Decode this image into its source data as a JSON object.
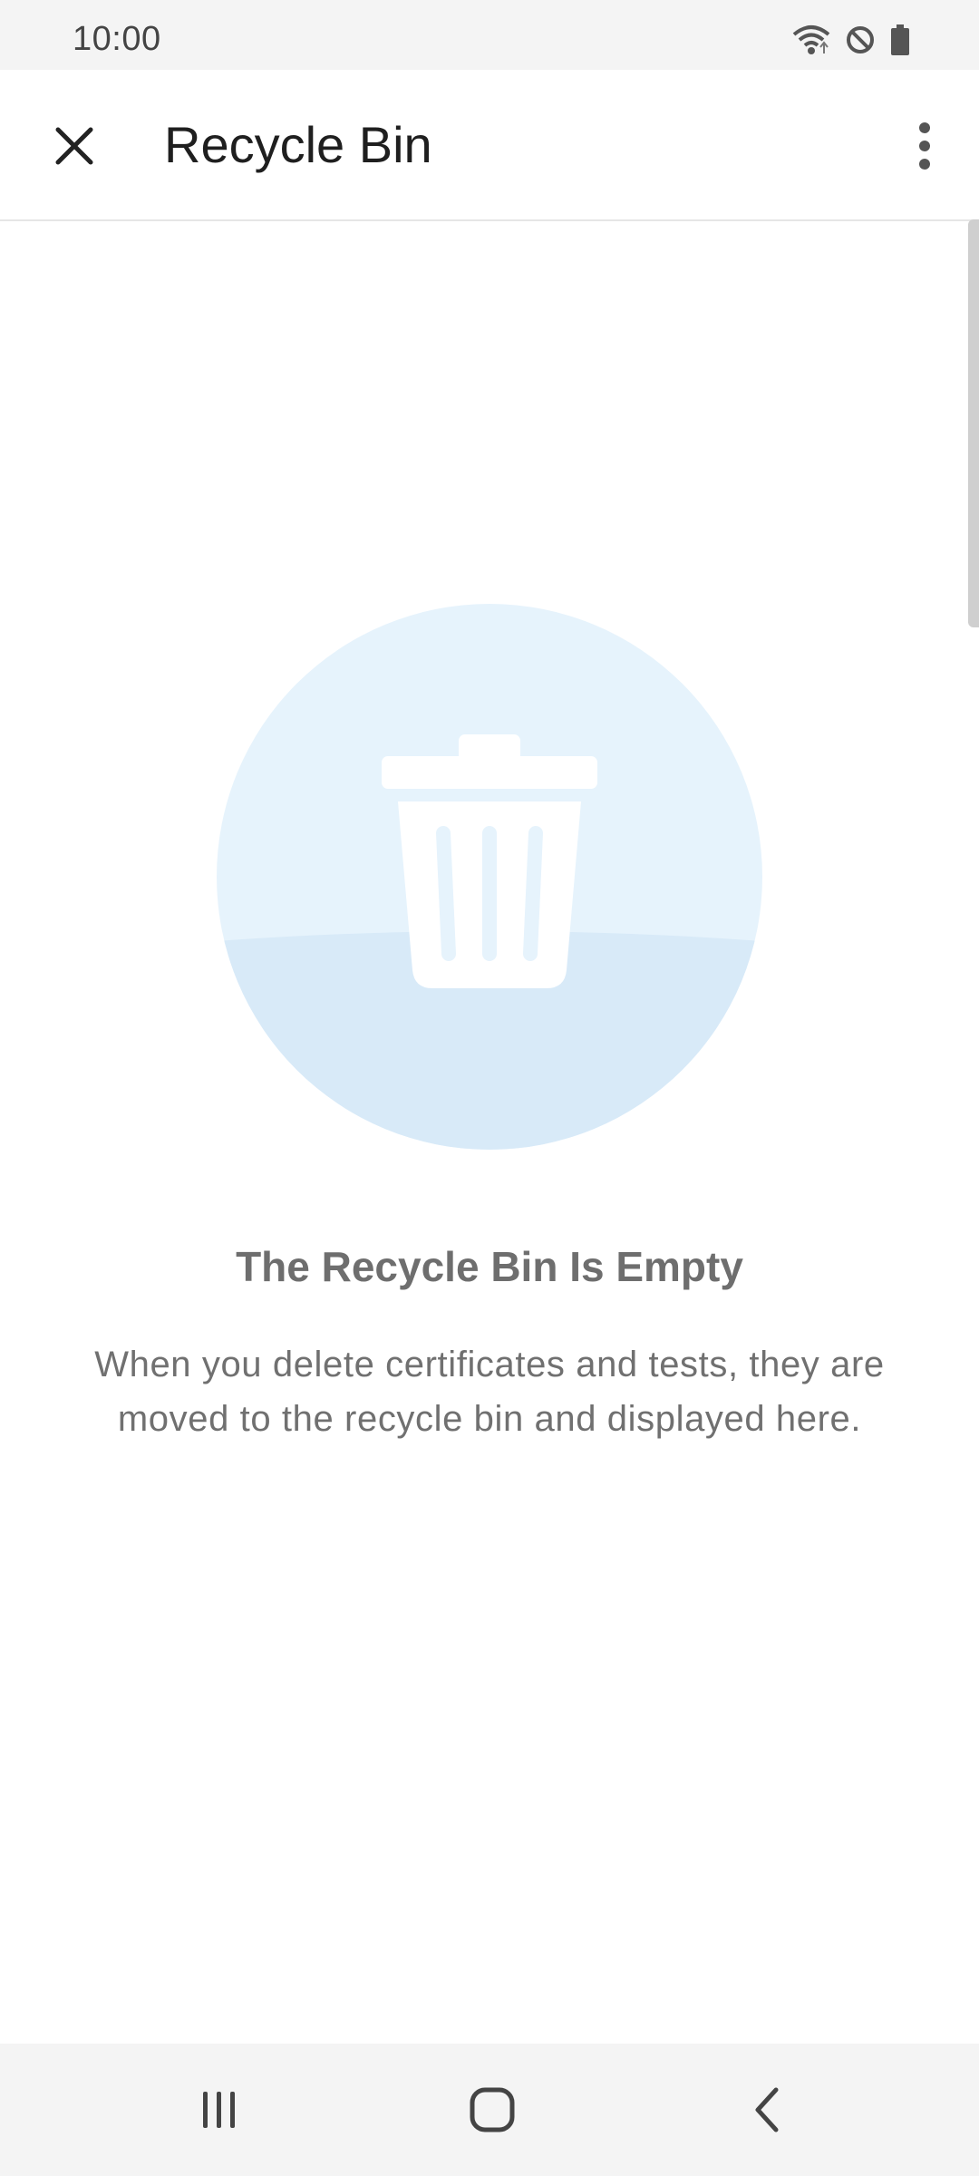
{
  "status_bar": {
    "time": "10:00",
    "icons": [
      "wifi-icon",
      "do-not-disturb-icon",
      "battery-icon"
    ]
  },
  "app_bar": {
    "title": "Recycle Bin",
    "close_icon": "close-icon",
    "more_icon": "more-vert-icon"
  },
  "empty_state": {
    "illustration_icon": "trash-bin-icon",
    "title": "The Recycle Bin Is Empty",
    "description": "When you delete certificates and tests, they are moved to the recycle bin and displayed here."
  },
  "nav_bar": {
    "icons": [
      "recents-icon",
      "home-icon",
      "back-icon"
    ]
  },
  "colors": {
    "illustration_light": "#e6f3fc",
    "illustration_dark": "#d8eaf8",
    "title_text": "#1f1f1f",
    "secondary_text": "#707070"
  }
}
